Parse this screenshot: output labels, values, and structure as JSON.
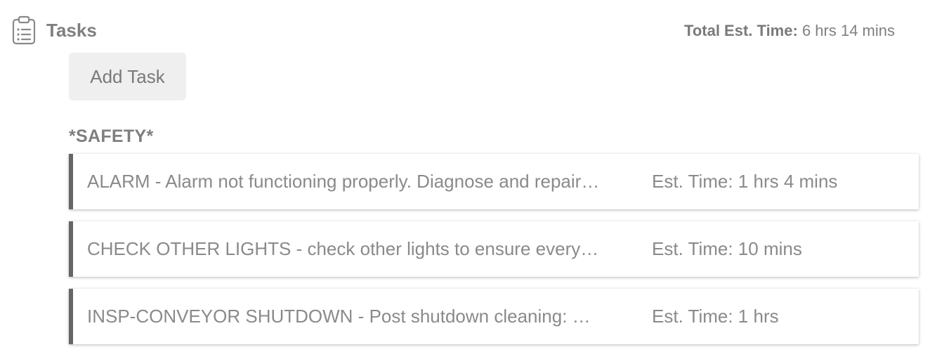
{
  "header": {
    "title": "Tasks",
    "icon": "clipboard-list-icon",
    "total_label": "Total Est. Time:",
    "total_value": "6 hrs 14 mins"
  },
  "actions": {
    "add_task_label": "Add Task"
  },
  "groups": [
    {
      "title": "*SAFETY*",
      "tasks": [
        {
          "description": "ALARM - Alarm not functioning properly. Diagnose and repair…",
          "time": "Est. Time: 1 hrs 4 mins"
        },
        {
          "description": "CHECK OTHER LIGHTS - check other lights to ensure every…",
          "time": "Est. Time: 10 mins"
        },
        {
          "description": "INSP-CONVEYOR SHUTDOWN - Post shutdown cleaning: …",
          "time": "Est. Time: 1 hrs"
        }
      ]
    }
  ],
  "colors": {
    "accent_border": "#666666",
    "button_bg": "#efefef",
    "text": "#808080"
  }
}
